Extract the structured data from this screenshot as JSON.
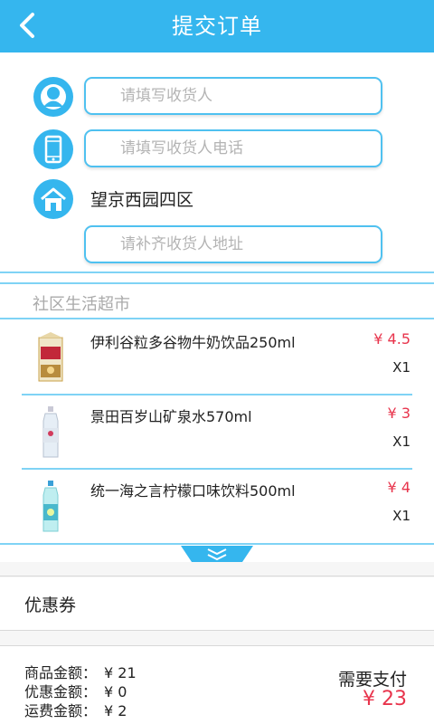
{
  "header": {
    "title": "提交订单"
  },
  "form": {
    "receiver_placeholder": "请填写收货人",
    "phone_placeholder": "请填写收货人电话",
    "community": "望京西园四区",
    "address_placeholder": "请补齐收货人地址"
  },
  "store": {
    "name": "社区生活超市",
    "items": [
      {
        "name": "伊利谷粒多谷物牛奶饮品250ml",
        "price": "¥ 4.5",
        "qty": "X1"
      },
      {
        "name": "景田百岁山矿泉水570ml",
        "price": "¥ 3",
        "qty": "X1"
      },
      {
        "name": "统一海之言柠檬口味饮料500ml",
        "price": "¥ 4",
        "qty": "X1"
      }
    ]
  },
  "coupon": {
    "label": "优惠券"
  },
  "summary": {
    "goods_label": "商品金额：",
    "goods_value": "¥ 21",
    "discount_label": "优惠金额：",
    "discount_value": "¥ 0",
    "shipping_label": "运费金额：",
    "shipping_value": "¥ 2",
    "pay_label": "需要支付",
    "pay_amount": "¥ 23"
  },
  "colors": {
    "accent": "#35b6ee",
    "price": "#e8344c",
    "divider": "#7fd3f5"
  },
  "icons": [
    "back-arrow-icon",
    "user-icon",
    "phone-icon",
    "house-icon",
    "expand-chevron-icon"
  ]
}
